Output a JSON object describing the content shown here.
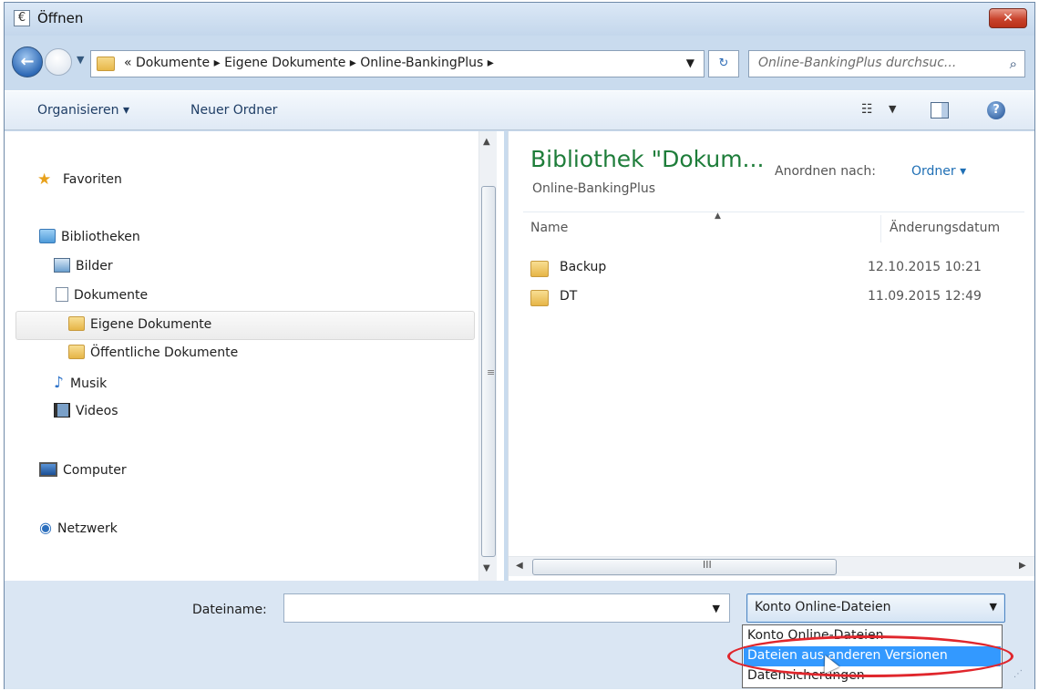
{
  "window": {
    "title": "Öffnen",
    "app_icon": "€",
    "close_label": "✕"
  },
  "nav": {
    "back_icon": "back-arrow-icon",
    "address": "« Dokumente ▸ Eigene Dokumente ▸ Online-BankingPlus ▸",
    "search_placeholder": "Online-BankingPlus durchsuc..."
  },
  "toolbar": {
    "organize": "Organisieren ▾",
    "new_folder": "Neuer Ordner"
  },
  "tree": {
    "favorites": "Favoriten",
    "libraries": "Bibliotheken",
    "pictures": "Bilder",
    "documents": "Dokumente",
    "my_documents": "Eigene Dokumente",
    "public_documents": "Öffentliche Dokumente",
    "music": "Musik",
    "videos": "Videos",
    "computer": "Computer",
    "network": "Netzwerk"
  },
  "content": {
    "library_title": "Bibliothek \"Dokum...",
    "library_subtitle": "Online-BankingPlus",
    "arrange_label": "Anordnen nach:",
    "arrange_value": "Ordner ▾",
    "columns": {
      "name": "Name",
      "date": "Änderungsdatum"
    },
    "rows": [
      {
        "name": "Backup",
        "date": "12.10.2015 10:21"
      },
      {
        "name": "DT",
        "date": "11.09.2015 12:49"
      }
    ],
    "hscroll_grip": "III"
  },
  "bottom": {
    "filename_label": "Dateiname:",
    "filename_value": "",
    "filetype_selected": "Konto Online-Dateien",
    "filetype_options": [
      "Konto Online-Dateien",
      "Dateien aus anderen Versionen",
      "Datensicherungen"
    ],
    "highlighted_option": 1
  },
  "colors": {
    "accent": "#3399ff",
    "highlight_ring": "#e0262c",
    "library_title": "#1e7d3a"
  }
}
